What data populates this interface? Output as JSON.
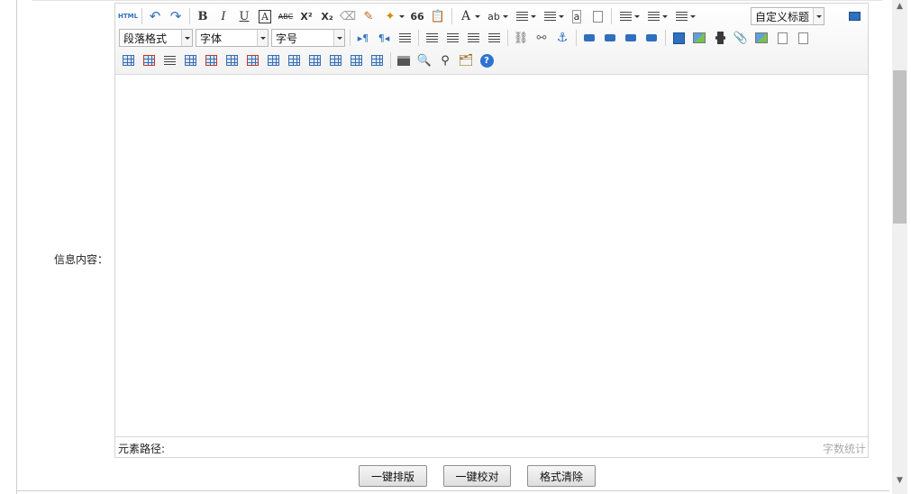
{
  "form": {
    "content_label": "信息内容："
  },
  "editor": {
    "toolbar": {
      "html_label": "HTML",
      "bold": "B",
      "italic": "I",
      "underline": "U",
      "font_border": "A",
      "strikethrough": "ABC",
      "superscript": "X²",
      "subscript": "X₂",
      "quote": "66",
      "font_color": "A",
      "paragraph_select": "段落格式",
      "font_select": "字体",
      "size_select": "字号",
      "custom_title_select": "自定义标题"
    },
    "status": {
      "element_path": "元素路径:",
      "word_count": "字数统计"
    }
  },
  "actions": {
    "typeset": "一键排版",
    "proofread": "一键校对",
    "clear_format": "格式清除"
  }
}
